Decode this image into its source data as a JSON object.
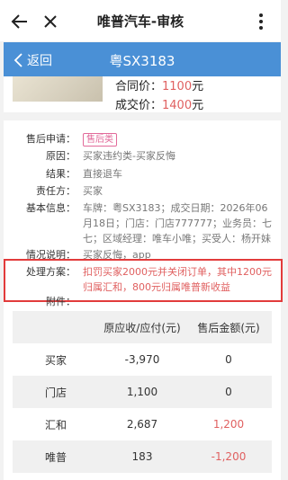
{
  "topbar": {
    "title": "唯普汽车-审核"
  },
  "header": {
    "back_label": "返回",
    "plate": "粤SX3183"
  },
  "car": {
    "contract_label": "合同价：",
    "contract_value": "1100",
    "contract_unit": "元",
    "deal_label": "成交价：",
    "deal_value": "1400",
    "deal_unit": "元"
  },
  "info": {
    "after_sale": {
      "label": "售后申请：",
      "tag": "售后类"
    },
    "reason": {
      "label": "原因：",
      "value": "买家违约类-买家反悔"
    },
    "result": {
      "label": "结果：",
      "value": "直接退车"
    },
    "responsible": {
      "label": "责任方：",
      "value": "买家"
    },
    "basic": {
      "label": "基本信息：",
      "value": "车牌：粤SX3183；成交日期：2026年06月18日；门店：门店777777；业务员：七七；区域经理：唯车小唯；买受人：杨开妹"
    },
    "desc": {
      "label": "情况说明：",
      "value": "买家反悔，app"
    },
    "plan": {
      "label": "处理方案：",
      "value": "扣罚买家2000元并关闭订单，其中1200元归属汇和，800元归属唯普新收益"
    },
    "attach": {
      "label": "附件："
    }
  },
  "table": {
    "headers": [
      "",
      "原应收/应付(元)",
      "售后金额(元)"
    ],
    "rows": [
      {
        "name": "买家",
        "orig": "-3,970",
        "after": "0"
      },
      {
        "name": "门店",
        "orig": "1,100",
        "after": "0"
      },
      {
        "name": "汇和",
        "orig": "2,687",
        "after": "1,200"
      },
      {
        "name": "唯普",
        "orig": "183",
        "after": "-1,200"
      }
    ]
  }
}
